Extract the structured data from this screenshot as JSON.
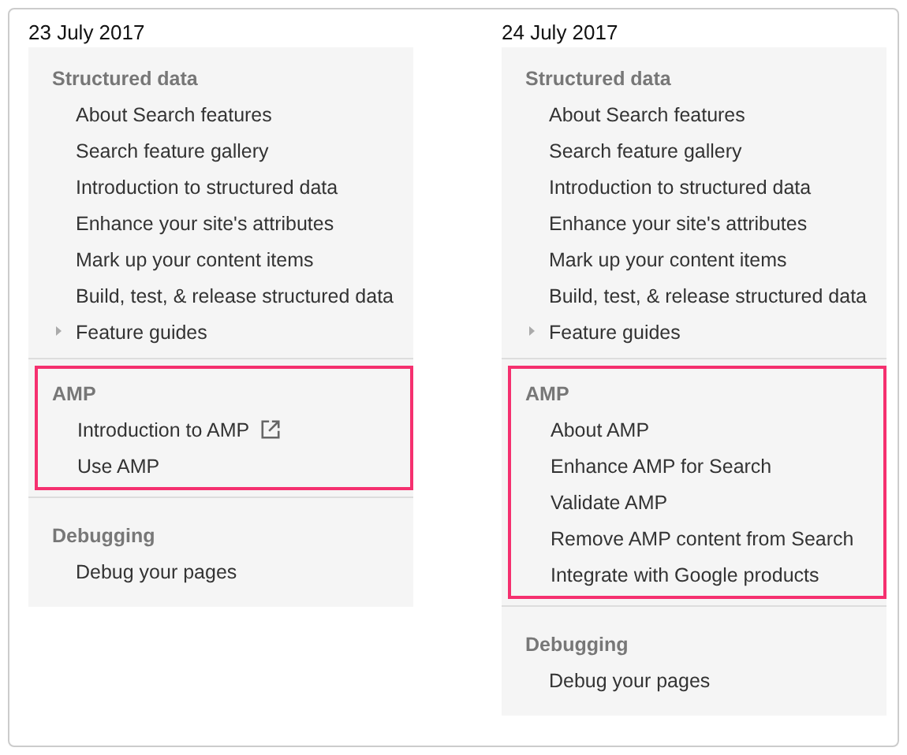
{
  "columns": [
    {
      "date": "23 July 2017",
      "sections": [
        {
          "title": "Structured data",
          "highlighted": false,
          "items": [
            {
              "label": "About Search features",
              "kind": "page"
            },
            {
              "label": "Search feature gallery",
              "kind": "page"
            },
            {
              "label": "Introduction to structured data",
              "kind": "page"
            },
            {
              "label": "Enhance your site's attributes",
              "kind": "page"
            },
            {
              "label": "Mark up your content items",
              "kind": "page"
            },
            {
              "label": "Build, test, & release structured data",
              "kind": "page"
            },
            {
              "label": "Feature guides",
              "kind": "group",
              "expanded": false
            }
          ]
        },
        {
          "title": "AMP",
          "highlighted": true,
          "items": [
            {
              "label": "Introduction to AMP",
              "kind": "external"
            },
            {
              "label": "Use AMP",
              "kind": "page"
            }
          ]
        },
        {
          "title": "Debugging",
          "highlighted": false,
          "items": [
            {
              "label": "Debug your pages",
              "kind": "page"
            }
          ]
        }
      ]
    },
    {
      "date": "24 July 2017",
      "sections": [
        {
          "title": "Structured data",
          "highlighted": false,
          "items": [
            {
              "label": "About Search features",
              "kind": "page"
            },
            {
              "label": "Search feature gallery",
              "kind": "page"
            },
            {
              "label": "Introduction to structured data",
              "kind": "page"
            },
            {
              "label": "Enhance your site's attributes",
              "kind": "page"
            },
            {
              "label": "Mark up your content items",
              "kind": "page"
            },
            {
              "label": "Build, test, & release structured data",
              "kind": "page"
            },
            {
              "label": "Feature guides",
              "kind": "group",
              "expanded": false
            }
          ]
        },
        {
          "title": "AMP",
          "highlighted": true,
          "items": [
            {
              "label": "About AMP",
              "kind": "page"
            },
            {
              "label": "Enhance AMP for Search",
              "kind": "page"
            },
            {
              "label": "Validate AMP",
              "kind": "page"
            },
            {
              "label": "Remove AMP content from Search",
              "kind": "page"
            },
            {
              "label": "Integrate with Google products",
              "kind": "page"
            }
          ]
        },
        {
          "title": "Debugging",
          "highlighted": false,
          "items": [
            {
              "label": "Debug your pages",
              "kind": "page"
            }
          ]
        }
      ]
    }
  ]
}
